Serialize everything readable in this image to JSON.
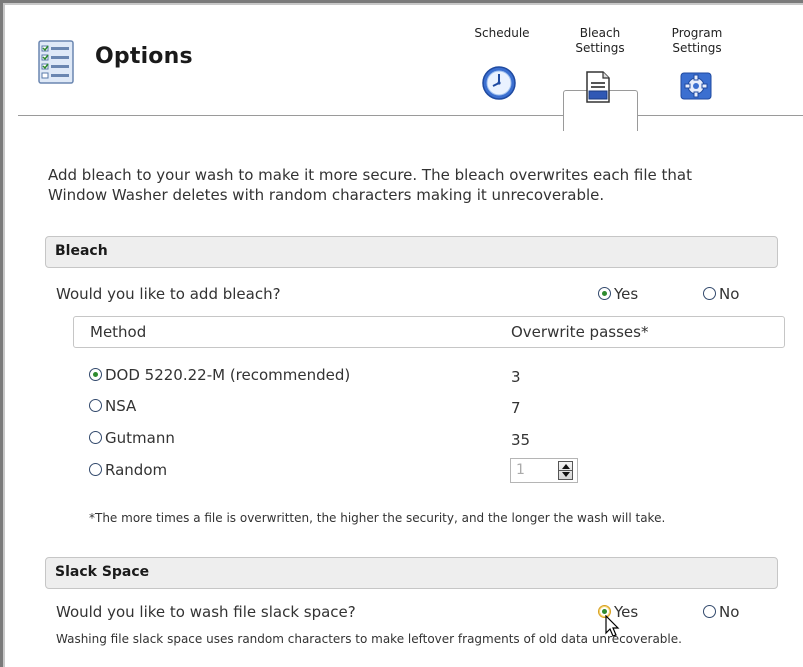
{
  "header": {
    "title": "Options",
    "tabs": [
      {
        "line1": "Schedule",
        "line2": "",
        "icon": "clock-icon"
      },
      {
        "line1": "Bleach",
        "line2": "Settings",
        "icon": "document-icon"
      },
      {
        "line1": "Program",
        "line2": "Settings",
        "icon": "gear-icon"
      }
    ],
    "active_tab": 1
  },
  "intro": {
    "line1": "Add bleach to your wash to make it more secure. The bleach overwrites each file that",
    "line2": "Window Washer deletes with random characters making it unrecoverable."
  },
  "bleach": {
    "section_title": "Bleach",
    "question": "Would you like to add bleach?",
    "yes_label": "Yes",
    "no_label": "No",
    "selected": "Yes",
    "table": {
      "col_method": "Method",
      "col_passes": "Overwrite passes*",
      "rows": [
        {
          "method": "DOD 5220.22-M (recommended)",
          "passes": "3",
          "selected": true
        },
        {
          "method": "NSA",
          "passes": "7",
          "selected": false
        },
        {
          "method": "Gutmann",
          "passes": "35",
          "selected": false
        },
        {
          "method": "Random",
          "passes": "1",
          "selected": false
        }
      ]
    },
    "note": "*The more times a file is overwritten, the higher the security, and the longer the wash will take."
  },
  "slack": {
    "section_title": "Slack Space",
    "question": "Would you like to wash file slack space?",
    "yes_label": "Yes",
    "no_label": "No",
    "selected": "Yes",
    "note": "Washing file slack space uses random characters to make leftover fragments of old data unrecoverable."
  },
  "colors": {
    "section_bg": "#eeeeee",
    "radio_selected": "#2e8b2e",
    "radio_border": "#334a6d",
    "icon_blue": "#3b6fd0"
  }
}
